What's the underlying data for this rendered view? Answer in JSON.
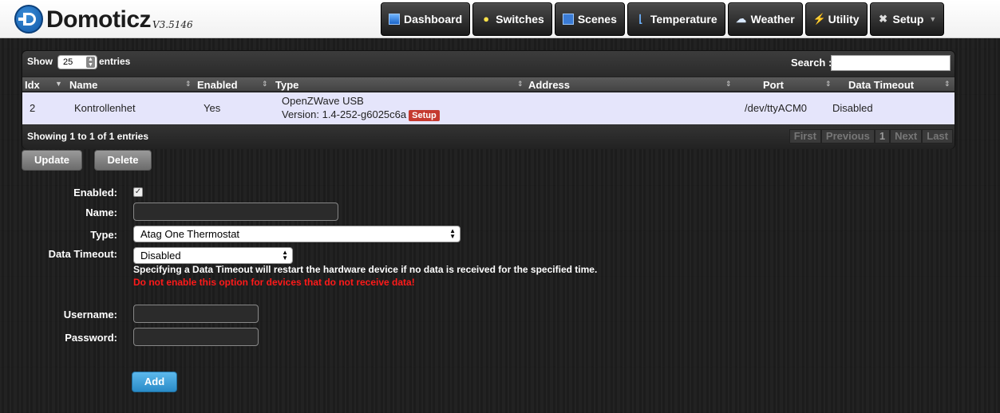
{
  "app": {
    "name": "Domoticz",
    "version": "V3.5146"
  },
  "nav": [
    {
      "label": "Dashboard",
      "icon": "dashboard-icon"
    },
    {
      "label": "Switches",
      "icon": "lightbulb-icon"
    },
    {
      "label": "Scenes",
      "icon": "clapperboard-icon"
    },
    {
      "label": "Temperature",
      "icon": "thermometer-icon"
    },
    {
      "label": "Weather",
      "icon": "cloud-rain-icon"
    },
    {
      "label": "Utility",
      "icon": "lightning-icon"
    },
    {
      "label": "Setup",
      "icon": "tools-icon"
    }
  ],
  "table": {
    "show_label": "Show",
    "page_size": "25",
    "entries_label": "entries",
    "search_label": "Search :",
    "search_value": "",
    "columns": [
      "Idx",
      "Name",
      "Enabled",
      "Type",
      "Address",
      "Port",
      "Data Timeout"
    ],
    "rows": [
      {
        "idx": "2",
        "name": "Kontrollenhet",
        "enabled": "Yes",
        "type": "OpenZWave USB",
        "version": "Version: 1.4-252-g6025c6a",
        "setup_label": "Setup",
        "address": "",
        "port": "/dev/ttyACM0",
        "data_timeout": "Disabled"
      }
    ],
    "info": "Showing 1 to 1 of 1 entries",
    "pager": [
      "First",
      "Previous",
      "1",
      "Next",
      "Last"
    ]
  },
  "actions": {
    "update": "Update",
    "delete": "Delete"
  },
  "form": {
    "enabled_label": "Enabled:",
    "enabled_checked": true,
    "name_label": "Name:",
    "name_value": "",
    "type_label": "Type:",
    "type_value": "Atag One Thermostat",
    "timeout_label": "Data Timeout:",
    "timeout_value": "Disabled",
    "timeout_help": "Specifying a Data Timeout will restart the hardware device if no data is received for the specified time.",
    "timeout_warning": "Do not enable this option for devices that do not receive data!",
    "username_label": "Username:",
    "username_value": "",
    "password_label": "Password:",
    "password_value": "",
    "add_label": "Add"
  },
  "colors": {
    "header_bg": "#f4f4f4",
    "row_bg": "#e5e5fb",
    "setup_badge": "#c53a30",
    "warning": "#ff1a1a",
    "add_button": "#3a9ad8"
  }
}
